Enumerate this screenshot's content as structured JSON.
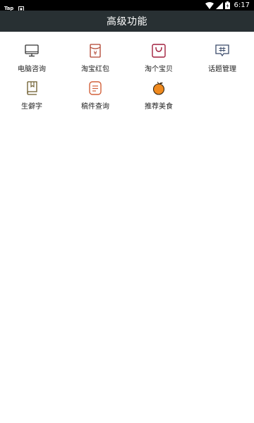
{
  "status_bar": {
    "app_label": "Tap",
    "time": "6:17"
  },
  "header": {
    "title": "高级功能"
  },
  "features": [
    {
      "label": "电脑咨询",
      "icon": "monitor-icon",
      "color": "#333333"
    },
    {
      "label": "淘宝红包",
      "icon": "red-envelope-icon",
      "color": "#b0412e"
    },
    {
      "label": "淘个宝贝",
      "icon": "shopping-bag-icon",
      "color": "#a11f3d"
    },
    {
      "label": "话题管理",
      "icon": "topic-hashtag-icon",
      "color": "#3a4a6a"
    },
    {
      "label": "生僻字",
      "icon": "dictionary-book-icon",
      "color": "#6b5a2a"
    },
    {
      "label": "稿件查询",
      "icon": "document-list-icon",
      "color": "#d2603a"
    },
    {
      "label": "推荐美食",
      "icon": "orange-fruit-icon",
      "color": "#f08a1e"
    }
  ]
}
